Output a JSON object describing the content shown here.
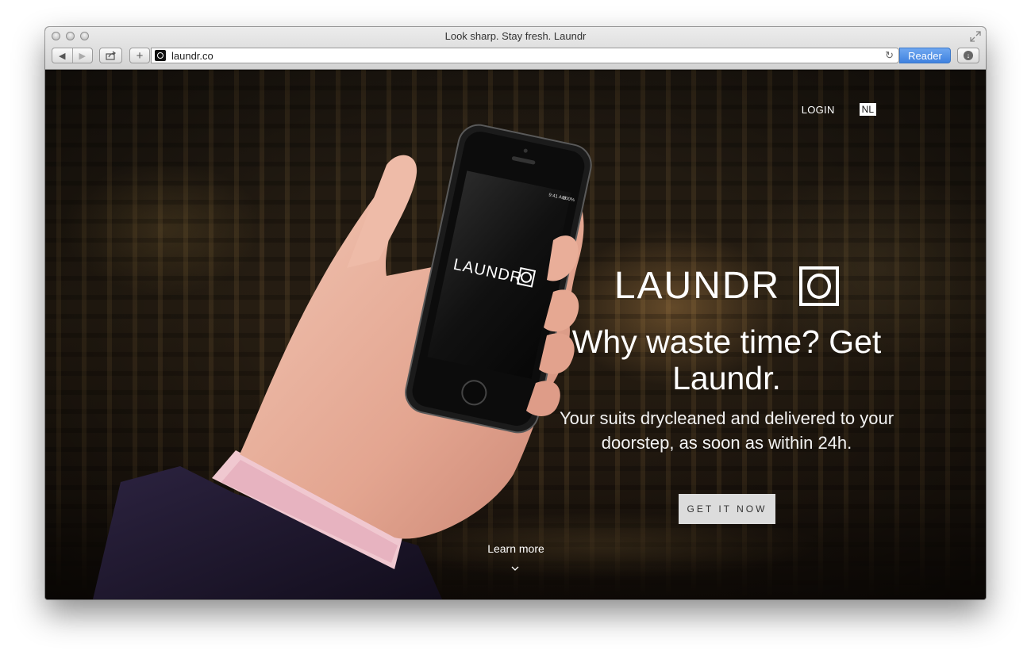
{
  "window": {
    "title": "Look sharp. Stay fresh. Laundr"
  },
  "toolbar": {
    "back_icon": "◀",
    "forward_icon": "▶",
    "add_icon": "+",
    "url": "laundr.co",
    "reload_icon": "↻",
    "reader_label": "Reader",
    "download_icon": "↓"
  },
  "nav": {
    "login": "LOGIN",
    "language": "NL"
  },
  "hero": {
    "brand": "LAUNDR",
    "headline": "Why waste time? Get Laundr.",
    "subline": "Your suits drycleaned and delivered to your doorstep, as soon as within 24h.",
    "cta": "GET IT NOW",
    "learn_more": "Learn more"
  },
  "phone": {
    "status_time": "9:41 AM",
    "status_battery": "100%",
    "screen_brand": "LAUNDR"
  }
}
